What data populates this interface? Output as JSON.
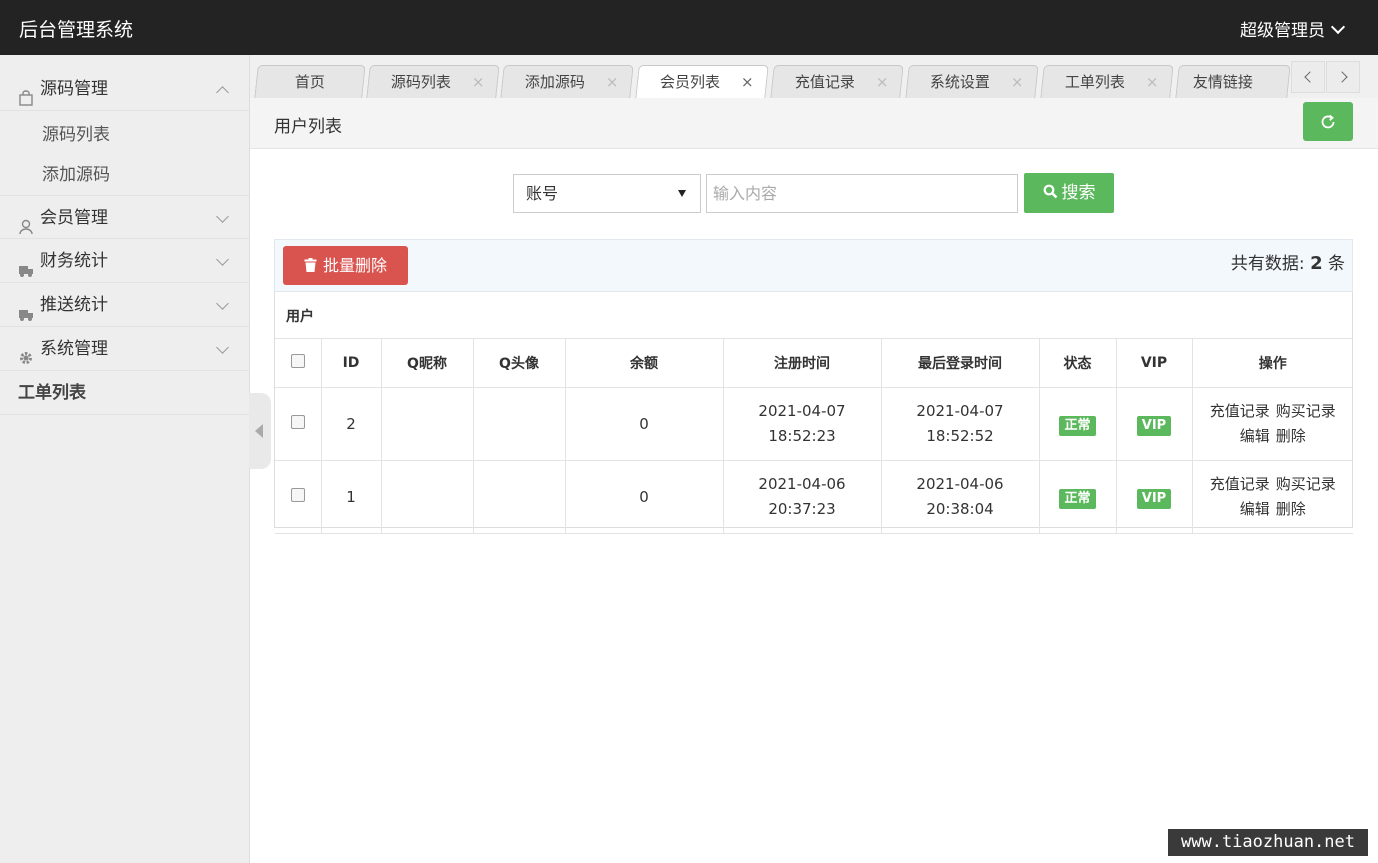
{
  "app": {
    "title": "后台管理系统",
    "user": "超级管理员"
  },
  "sidebar": {
    "groups": [
      {
        "label": "源码管理",
        "icon": "bag-icon",
        "expanded": true,
        "children": [
          "源码列表",
          "添加源码"
        ]
      },
      {
        "label": "会员管理",
        "icon": "user-icon",
        "expanded": false
      },
      {
        "label": "财务统计",
        "icon": "truck-icon",
        "expanded": false
      },
      {
        "label": "推送统计",
        "icon": "truck-icon",
        "expanded": false
      },
      {
        "label": "系统管理",
        "icon": "gear-icon",
        "expanded": false
      }
    ],
    "standalone": "工单列表"
  },
  "tabs": [
    {
      "label": "首页"
    },
    {
      "label": "源码列表"
    },
    {
      "label": "添加源码"
    },
    {
      "label": "会员列表",
      "active": true
    },
    {
      "label": "充值记录"
    },
    {
      "label": "系统设置"
    },
    {
      "label": "工单列表"
    },
    {
      "label": "友情链接"
    }
  ],
  "tab_close_glyph": "×",
  "page": {
    "title": "用户列表"
  },
  "search": {
    "field_selected": "账号",
    "placeholder": "输入内容",
    "button_label": "搜索"
  },
  "toolbar": {
    "batch_delete_label": "批量删除",
    "count_prefix": "共有数据:",
    "count": "2",
    "count_suffix": "条"
  },
  "table": {
    "caption": "用户",
    "headers": [
      "ID",
      "Q昵称",
      "Q头像",
      "余额",
      "注册时间",
      "最后登录时间",
      "状态",
      "VIP",
      "操作"
    ],
    "highlight_color": "#cc0000",
    "rows": [
      {
        "id": "2",
        "nick": "",
        "avatar": "",
        "balance": "0",
        "reg_time": "2021-04-07 18:52:23",
        "last_login": "2021-04-07 18:52:52",
        "status": "正常",
        "vip": "VIP",
        "actions": [
          "充值记录",
          "购买记录",
          "编辑",
          "删除"
        ]
      },
      {
        "id": "1",
        "nick": "",
        "avatar": "",
        "balance": "0",
        "reg_time": "2021-04-06 20:37:23",
        "last_login": "2021-04-06 20:38:04",
        "status": "正常",
        "vip": "VIP",
        "actions": [
          "充值记录",
          "购买记录",
          "编辑",
          "删除"
        ]
      }
    ]
  },
  "colors": {
    "success": "#5cb85c",
    "danger": "#d9534f",
    "topbar": "#232323"
  },
  "watermark": "www.tiaozhuan.net"
}
